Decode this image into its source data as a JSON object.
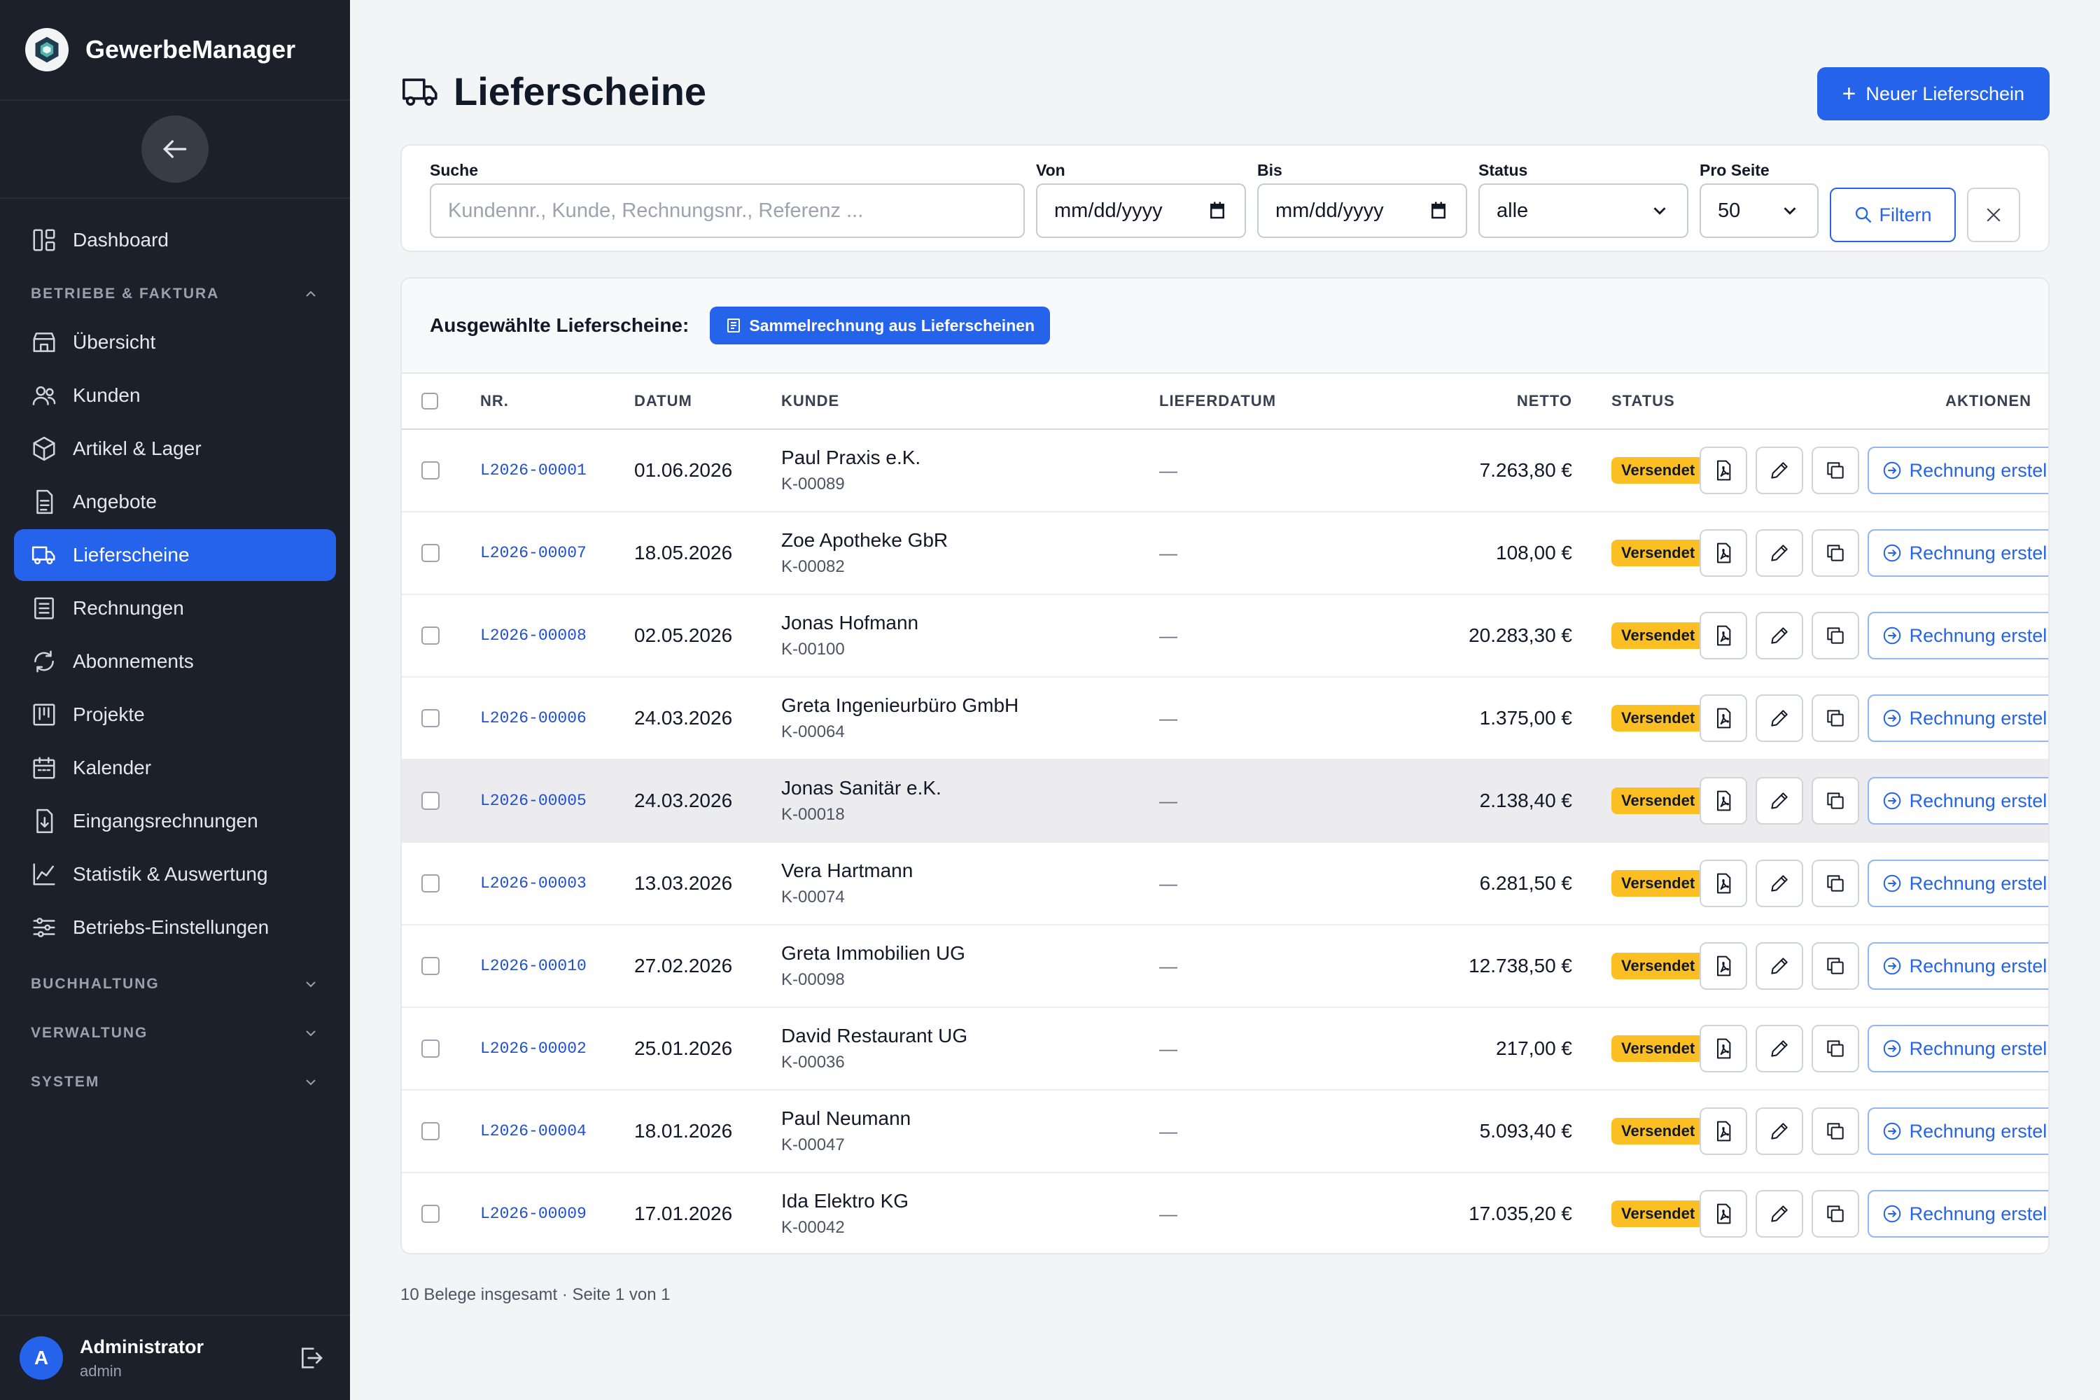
{
  "app": {
    "name": "GewerbeManager",
    "user": {
      "name": "Administrator",
      "role": "admin",
      "initial": "A"
    }
  },
  "sidebar": {
    "dashboard": "Dashboard",
    "sections": [
      {
        "label": "BETRIEBE & FAKTURA",
        "expanded": true,
        "items": [
          {
            "label": "Übersicht",
            "icon": "store-icon"
          },
          {
            "label": "Kunden",
            "icon": "users-icon"
          },
          {
            "label": "Artikel & Lager",
            "icon": "box-icon"
          },
          {
            "label": "Angebote",
            "icon": "document-icon"
          },
          {
            "label": "Lieferscheine",
            "icon": "truck-icon",
            "active": true
          },
          {
            "label": "Rechnungen",
            "icon": "receipt-icon"
          },
          {
            "label": "Abonnements",
            "icon": "refresh-icon"
          },
          {
            "label": "Projekte",
            "icon": "kanban-icon"
          },
          {
            "label": "Kalender",
            "icon": "calendar-icon"
          },
          {
            "label": "Eingangsrechnungen",
            "icon": "inbox-document-icon"
          },
          {
            "label": "Statistik & Auswertung",
            "icon": "chart-icon"
          },
          {
            "label": "Betriebs-Einstellungen",
            "icon": "sliders-icon"
          }
        ]
      },
      {
        "label": "BUCHHALTUNG",
        "expanded": false
      },
      {
        "label": "VERWALTUNG",
        "expanded": false
      },
      {
        "label": "SYSTEM",
        "expanded": false
      }
    ]
  },
  "page": {
    "title": "Lieferscheine",
    "new_button": "Neuer Lieferschein"
  },
  "filters": {
    "search_label": "Suche",
    "search_placeholder": "Kundennr., Kunde, Rechnungsnr., Referenz ...",
    "from_label": "Von",
    "from_value": "mm/dd/yyyy",
    "to_label": "Bis",
    "to_value": "mm/dd/yyyy",
    "status_label": "Status",
    "status_value": "alle",
    "per_page_label": "Pro Seite",
    "per_page_value": "50",
    "filter_button": "Filtern"
  },
  "bulk": {
    "label": "Ausgewählte Lieferscheine:",
    "button": "Sammelrechnung aus Lieferscheinen"
  },
  "table": {
    "columns": {
      "nr": "NR.",
      "datum": "DATUM",
      "kunde": "KUNDE",
      "lieferdatum": "LIEFERDATUM",
      "netto": "NETTO",
      "status": "STATUS",
      "aktionen": "AKTIONEN"
    },
    "invoice_label": "Rechnung erstellen",
    "rows": [
      {
        "nr": "L2026-00001",
        "datum": "01.06.2026",
        "kunde": "Paul Praxis e.K.",
        "kid": "K-00089",
        "lieferdatum": "—",
        "netto": "7.263,80 €",
        "status": "Versendet"
      },
      {
        "nr": "L2026-00007",
        "datum": "18.05.2026",
        "kunde": "Zoe Apotheke GbR",
        "kid": "K-00082",
        "lieferdatum": "—",
        "netto": "108,00 €",
        "status": "Versendet"
      },
      {
        "nr": "L2026-00008",
        "datum": "02.05.2026",
        "kunde": "Jonas Hofmann",
        "kid": "K-00100",
        "lieferdatum": "—",
        "netto": "20.283,30 €",
        "status": "Versendet"
      },
      {
        "nr": "L2026-00006",
        "datum": "24.03.2026",
        "kunde": "Greta Ingenieurbüro GmbH",
        "kid": "K-00064",
        "lieferdatum": "—",
        "netto": "1.375,00 €",
        "status": "Versendet"
      },
      {
        "nr": "L2026-00005",
        "datum": "24.03.2026",
        "kunde": "Jonas Sanitär e.K.",
        "kid": "K-00018",
        "lieferdatum": "—",
        "netto": "2.138,40 €",
        "status": "Versendet"
      },
      {
        "nr": "L2026-00003",
        "datum": "13.03.2026",
        "kunde": "Vera Hartmann",
        "kid": "K-00074",
        "lieferdatum": "—",
        "netto": "6.281,50 €",
        "status": "Versendet"
      },
      {
        "nr": "L2026-00010",
        "datum": "27.02.2026",
        "kunde": "Greta Immobilien UG",
        "kid": "K-00098",
        "lieferdatum": "—",
        "netto": "12.738,50 €",
        "status": "Versendet"
      },
      {
        "nr": "L2026-00002",
        "datum": "25.01.2026",
        "kunde": "David Restaurant UG",
        "kid": "K-00036",
        "lieferdatum": "—",
        "netto": "217,00 €",
        "status": "Versendet"
      },
      {
        "nr": "L2026-00004",
        "datum": "18.01.2026",
        "kunde": "Paul Neumann",
        "kid": "K-00047",
        "lieferdatum": "—",
        "netto": "5.093,40 €",
        "status": "Versendet"
      },
      {
        "nr": "L2026-00009",
        "datum": "17.01.2026",
        "kunde": "Ida Elektro KG",
        "kid": "K-00042",
        "lieferdatum": "—",
        "netto": "17.035,20 €",
        "status": "Versendet"
      }
    ]
  },
  "footer": {
    "summary": "10 Belege insgesamt · Seite 1 von 1"
  },
  "colors": {
    "accent": "#2563eb",
    "sidebar": "#1b202b",
    "badge": "#fbbf24"
  }
}
